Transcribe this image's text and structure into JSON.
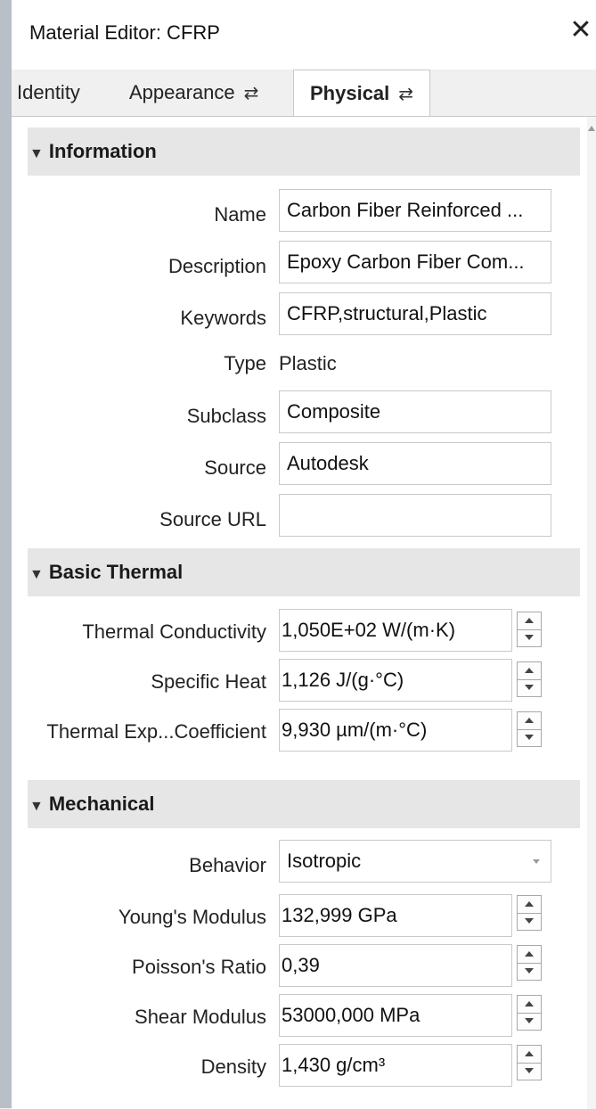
{
  "window": {
    "title": "Material Editor: CFRP",
    "close_glyph": "✕"
  },
  "tabs": [
    {
      "label": "Identity",
      "swap": ""
    },
    {
      "label": "Appearance",
      "swap": "⇄"
    },
    {
      "label": "Physical",
      "swap": "⇄"
    }
  ],
  "sections": {
    "information": {
      "title": "Information",
      "fields": {
        "name": {
          "label": "Name",
          "value": "Carbon Fiber Reinforced ..."
        },
        "description": {
          "label": "Description",
          "value": "Epoxy Carbon Fiber Com..."
        },
        "keywords": {
          "label": "Keywords",
          "value": "CFRP,structural,Plastic"
        },
        "type": {
          "label": "Type",
          "value": "Plastic"
        },
        "subclass": {
          "label": "Subclass",
          "value": "Composite"
        },
        "source": {
          "label": "Source",
          "value": "Autodesk"
        },
        "source_url": {
          "label": "Source URL",
          "value": ""
        }
      }
    },
    "basic_thermal": {
      "title": "Basic Thermal",
      "fields": {
        "thermal_conductivity": {
          "label": "Thermal Conductivity",
          "value": "1,050E+02 W/(m·K)"
        },
        "specific_heat": {
          "label": "Specific Heat",
          "value": "1,126 J/(g·°C)"
        },
        "thermal_expansion": {
          "label": "Thermal Exp...Coefficient",
          "value": "9,930 µm/(m·°C)"
        }
      }
    },
    "mechanical": {
      "title": "Mechanical",
      "fields": {
        "behavior": {
          "label": "Behavior",
          "value": "Isotropic"
        },
        "youngs_modulus": {
          "label": "Young's Modulus",
          "value": "132,999 GPa"
        },
        "poissons_ratio": {
          "label": "Poisson's Ratio",
          "value": "0,39"
        },
        "shear_modulus": {
          "label": "Shear Modulus",
          "value": "53000,000 MPa"
        },
        "density": {
          "label": "Density",
          "value": "1,430 g/cm³"
        }
      }
    }
  },
  "icons": {
    "collapse": "▼"
  }
}
